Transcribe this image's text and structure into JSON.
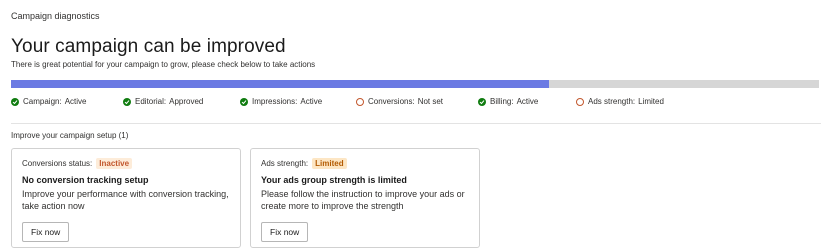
{
  "header": {
    "breadcrumb": "Campaign diagnostics",
    "title": "Your campaign can be improved",
    "subtitle": "There is great potential for your campaign to grow, please check below to take actions"
  },
  "progress": {
    "fraction": 0.666,
    "fill_color": "#6b7ae3",
    "track_color": "#d6d6d6"
  },
  "statuses": [
    {
      "label": "Campaign:",
      "value": "Active",
      "state": "ok",
      "icon": "check-circle-icon"
    },
    {
      "label": "Editorial:",
      "value": "Approved",
      "state": "ok",
      "icon": "check-circle-icon"
    },
    {
      "label": "Impressions:",
      "value": "Active",
      "state": "ok",
      "icon": "check-circle-icon"
    },
    {
      "label": "Conversions:",
      "value": "Not set",
      "state": "warning",
      "icon": "warning-circle-icon"
    },
    {
      "label": "Billing:",
      "value": "Active",
      "state": "ok",
      "icon": "check-circle-icon"
    },
    {
      "label": "Ads strength:",
      "value": "Limited",
      "state": "warning",
      "icon": "warning-circle-icon"
    }
  ],
  "section": {
    "title": "Improve your campaign setup (1)"
  },
  "cards": [
    {
      "status_label": "Conversions status:",
      "status_badge": "Inactive",
      "heading": "No conversion tracking setup",
      "body": "Improve your performance with conversion tracking, take action now",
      "button": "Fix now"
    },
    {
      "status_label": "Ads strength:",
      "status_badge": "Limited",
      "heading": "Your ads group strength is limited",
      "body": "Please follow the instruction to improve your ads or create more to improve the strength",
      "button": "Fix now"
    }
  ],
  "colors": {
    "ok": "#107c10",
    "warning": "#c2572d"
  }
}
